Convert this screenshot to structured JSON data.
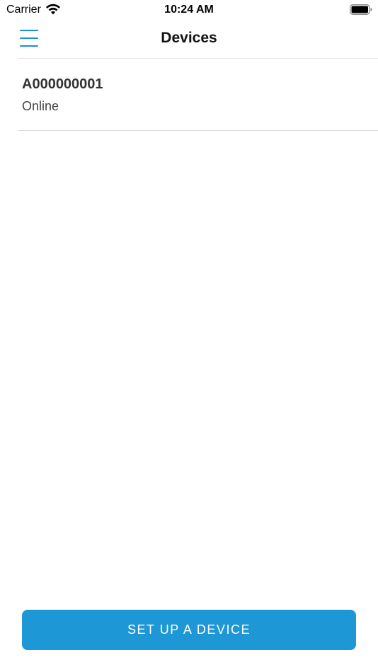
{
  "status_bar": {
    "carrier": "Carrier",
    "time": "10:24 AM",
    "wifi_icon": "wifi-icon",
    "battery_icon": "battery-icon"
  },
  "nav": {
    "title": "Devices",
    "menu_icon": "hamburger-menu-icon"
  },
  "devices": [
    {
      "name": "A000000001",
      "status": "Online"
    }
  ],
  "footer": {
    "setup_label": "SET UP A DEVICE"
  },
  "colors": {
    "accent": "#1e97d6",
    "menu_icon": "#1b8fd9"
  }
}
